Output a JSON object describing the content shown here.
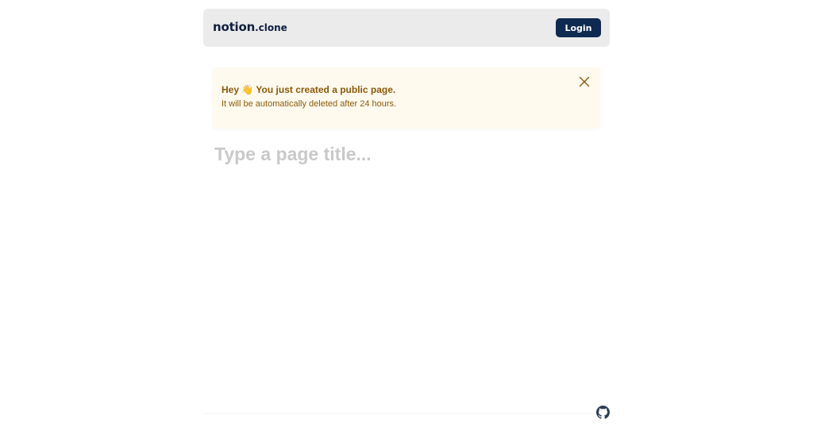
{
  "header": {
    "logo_main": "notion",
    "logo_suffix": ".clone",
    "login_label": "Login"
  },
  "notice": {
    "greeting": "Hey 👋",
    "title_rest": "You just created a public page.",
    "message": "It will be automatically deleted after 24 hours.",
    "close_icon": "close-icon"
  },
  "editor": {
    "title_placeholder": "Type a page title...",
    "title_value": ""
  },
  "footer": {
    "github_icon": "github-icon"
  },
  "colors": {
    "header_bg": "#ebebeb",
    "brand_navy": "#0f2a50",
    "notice_bg": "#fff9ee",
    "notice_text": "#8b5a08",
    "placeholder": "#c9c9c9"
  }
}
